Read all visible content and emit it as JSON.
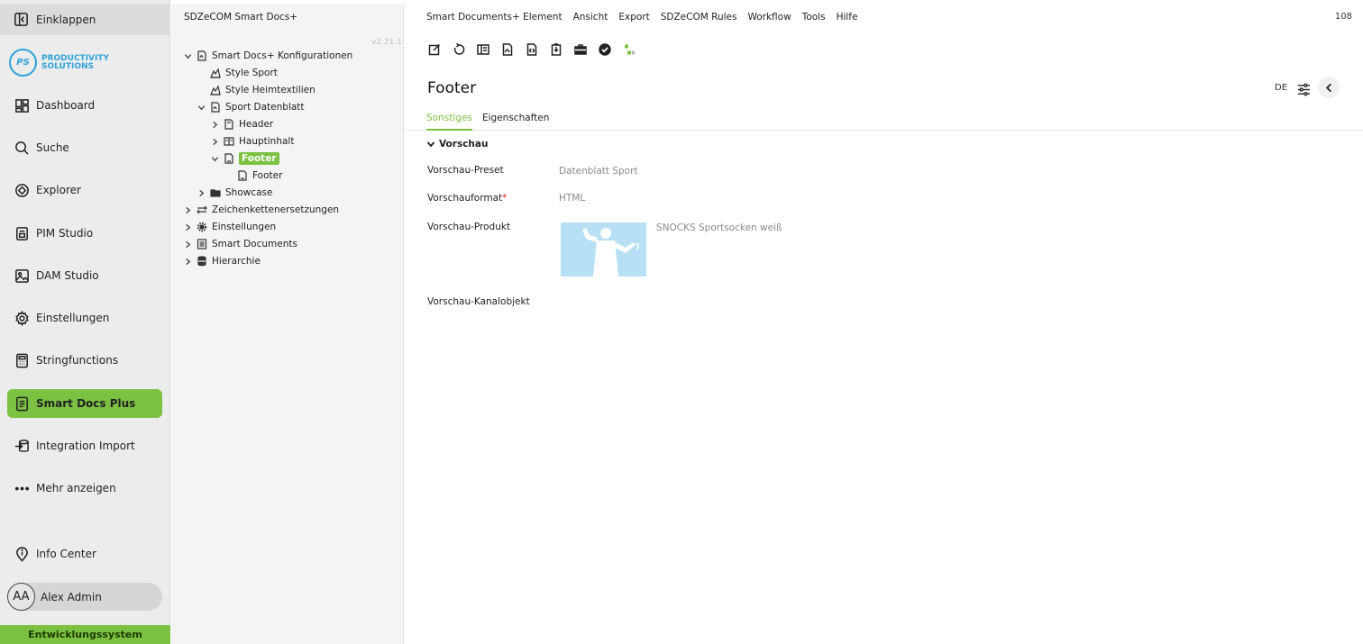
{
  "sidebar": {
    "collapse_label": "Einklappen",
    "logo": {
      "badge": "PS",
      "line1": "PRODUCTIVITY",
      "line2": "SOLUTIONS"
    },
    "items": [
      {
        "label": "Dashboard",
        "icon": "dashboard-icon"
      },
      {
        "label": "Suche",
        "icon": "search-icon"
      },
      {
        "label": "Explorer",
        "icon": "explorer-icon"
      },
      {
        "label": "PIM Studio",
        "icon": "pim-icon"
      },
      {
        "label": "DAM Studio",
        "icon": "image-icon"
      },
      {
        "label": "Einstellungen",
        "icon": "gear-icon"
      },
      {
        "label": "Stringfunctions",
        "icon": "calculator-icon"
      },
      {
        "label": "Smart Docs Plus",
        "icon": "document-icon",
        "active": true
      },
      {
        "label": "Integration Import",
        "icon": "import-icon"
      },
      {
        "label": "Mehr anzeigen",
        "icon": "more-icon"
      }
    ],
    "info_center": "Info Center",
    "user": {
      "initials": "AA",
      "name": "Alex Admin"
    },
    "env": "Entwicklungssystem"
  },
  "tree": {
    "title": "SDZeCOM Smart Docs+",
    "version": "v2.21.1",
    "nodes": [
      {
        "label": "Smart Docs+ Konfigurationen"
      },
      {
        "label": "Style Sport"
      },
      {
        "label": "Style Heimtextilien"
      },
      {
        "label": "Sport Datenblatt"
      },
      {
        "label": "Header"
      },
      {
        "label": "Hauptinhalt"
      },
      {
        "label": "Footer"
      },
      {
        "label": "Footer"
      },
      {
        "label": "Showcase"
      },
      {
        "label": "Zeichenkettenersetzungen"
      },
      {
        "label": "Einstellungen"
      },
      {
        "label": "Smart Documents"
      },
      {
        "label": "Hierarchie"
      }
    ]
  },
  "menubar": {
    "items": [
      "Smart Documents+ Element",
      "Ansicht",
      "Export",
      "SDZeCOM Rules",
      "Workflow",
      "Tools",
      "Hilfe"
    ],
    "count": "108"
  },
  "page": {
    "title": "Footer",
    "lang": "DE",
    "tabs": [
      "Sonstiges",
      "Eigenschaften"
    ],
    "section": "Vorschau",
    "fields": [
      {
        "label": "Vorschau-Preset",
        "value": "Datenblatt Sport"
      },
      {
        "label": "Vorschauformat",
        "required_mark": "*",
        "value": "HTML"
      },
      {
        "label": "Vorschau-Produkt",
        "value": "SNOCKS Sportsocken weiß"
      },
      {
        "label": "Vorschau-Kanalobjekt",
        "value": ""
      }
    ]
  },
  "colors": {
    "accent": "#7cc242",
    "logo": "#2fa3d9",
    "required": "#d31e1e"
  }
}
